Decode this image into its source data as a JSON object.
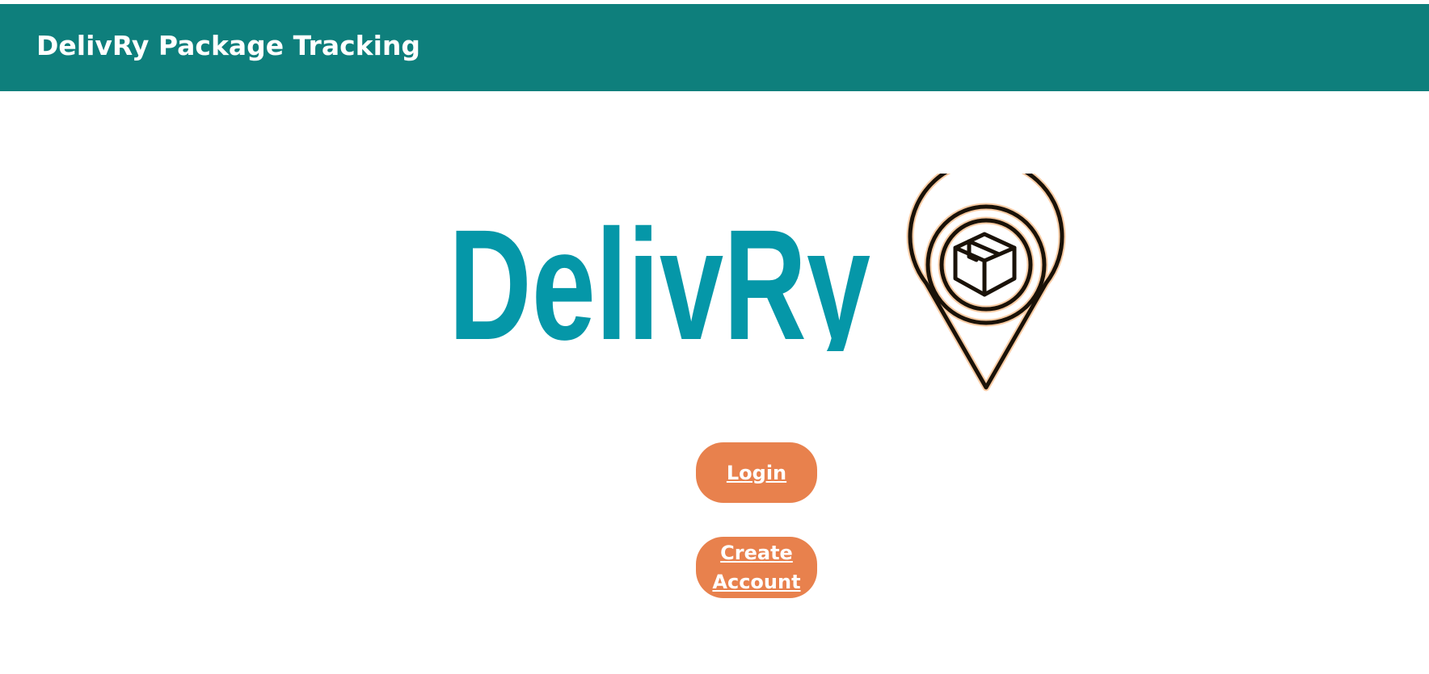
{
  "header": {
    "title": "DelivRy Package Tracking"
  },
  "logo": {
    "wordmark": "DelivRy",
    "wordmark_color": "#0597a8",
    "pin_icon": "location-pin-package-icon",
    "pin_color": "#e8872e"
  },
  "actions": {
    "login_label": "Login",
    "create_account_label": "Create Account"
  },
  "colors": {
    "header_bg": "#0e7f7c",
    "button_bg": "#e8814d",
    "button_text": "#ffffff"
  }
}
